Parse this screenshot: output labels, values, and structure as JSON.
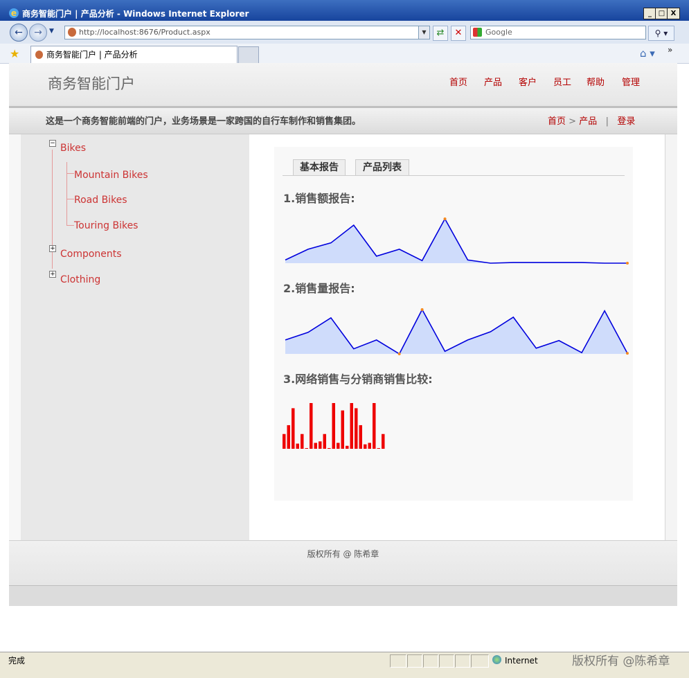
{
  "window": {
    "title": "商务智能门户 | 产品分析 - Windows Internet Explorer",
    "minimize": "_",
    "maximize": "□",
    "close": "X"
  },
  "address_bar": {
    "url": "http://localhost:8676/Product.aspx",
    "search_placeholder": "Google"
  },
  "tab": {
    "label": "商务智能门户 | 产品分析"
  },
  "site": {
    "title": "商务智能门户",
    "nav": [
      "首页",
      "产品",
      "客户",
      "员工",
      "帮助",
      "管理"
    ],
    "tagline": "这是一个商务智能前端的门户，业务场景是一家跨国的自行车制作和销售集团。",
    "breadcrumb": {
      "home": "首页",
      "arrow": ">",
      "current": "产品",
      "divider": "|",
      "login": "登录"
    }
  },
  "tree": {
    "bikes": "Bikes",
    "mountain": "Mountain Bikes",
    "road": "Road Bikes",
    "touring": "Touring Bikes",
    "components": "Components",
    "clothing": "Clothing",
    "collapse": "−",
    "expand": "+"
  },
  "tabs": [
    "基本报告",
    "产品列表"
  ],
  "reports": {
    "r1": "1.销售额报告:",
    "r2": "2.销售量报告:",
    "r3": "3.网络销售与分销商销售比较:"
  },
  "chart_data": [
    {
      "type": "area",
      "title": "",
      "values": [
        5,
        22,
        32,
        60,
        11,
        22,
        4,
        70,
        5,
        0,
        1,
        1,
        1,
        1,
        0,
        0
      ],
      "highlight_max_index": 7,
      "highlight_last_index": 15,
      "fill": "#cfdcfb",
      "stroke": "#0000dd",
      "marker": "#f58a1f"
    },
    {
      "type": "area",
      "title": "",
      "values": [
        22,
        34,
        57,
        8,
        22,
        0,
        70,
        4,
        22,
        35,
        58,
        9,
        21,
        2,
        68,
        1
      ],
      "highlight_max_index": 6,
      "highlight_last_index": 15,
      "highlight_min_index": 5,
      "fill": "#cfdcfb",
      "stroke": "#0000dd",
      "marker": "#f58a1f"
    },
    {
      "type": "bar",
      "title": "",
      "values": [
        20,
        32,
        55,
        7,
        20,
        0,
        62,
        8,
        10,
        20,
        0,
        62,
        8,
        52,
        4,
        62,
        55,
        32,
        6,
        8,
        62,
        0,
        20
      ],
      "color": "#ee0000"
    }
  ],
  "footer": {
    "text": "版权所有 @ 陈希章"
  },
  "status": {
    "left": "完成",
    "zone": "Internet",
    "watermark": "版权所有 @陈希章"
  },
  "icons": [
    "ie-logo-icon",
    "back-icon",
    "forward-icon",
    "page-icon",
    "refresh-icon",
    "stop-icon",
    "google-icon",
    "search-icon",
    "favorites-star-icon",
    "home-icon",
    "globe-icon"
  ]
}
